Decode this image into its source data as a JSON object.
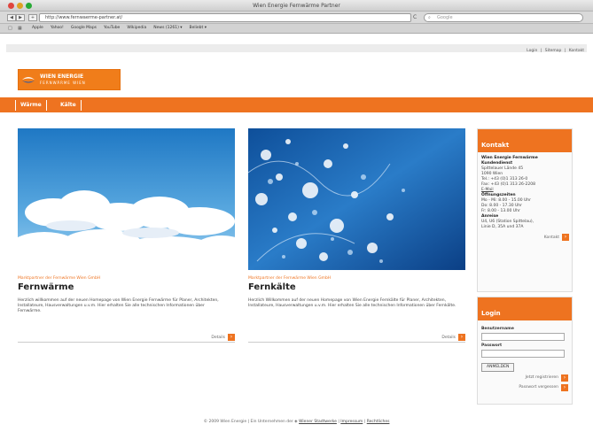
{
  "window": {
    "title": "Wien Energie Fernwärme Partner"
  },
  "browser": {
    "back_label": "◀",
    "forward_label": "▶",
    "add_label": "+",
    "url": "http://www.fernwaerme-partner.at/",
    "reload_label": "C",
    "search_placeholder": "Google",
    "bookmarks": [
      "Apple",
      "Yahoo!",
      "Google Maps",
      "YouTube",
      "Wikipedia",
      "News (1261) ▾",
      "Beliebt ▾"
    ]
  },
  "site": {
    "util_nav": {
      "login": "Login",
      "sitemap": "Sitemap",
      "kontakt": "Kontakt",
      "sep": "|"
    },
    "logo": {
      "line1": "WIEN ENERGIE",
      "line2": "FERNWÄRME WIEN"
    },
    "nav": {
      "waerme": "Wärme",
      "kaelte": "Kälte"
    }
  },
  "teasers": {
    "waerme": {
      "kicker": "Marktpartner der Fernwärme Wien GmbH",
      "title": "Fernwärme",
      "body": "Herzlich willkommen auf der neuen Homepage von Wien Energie Fernwärme für Planer, Architekten, Installateure, Hausverwaltungen u.v.m. Hier erhalten Sie alle technischen Informationen über Fernwärme.",
      "more": "Details"
    },
    "kaelte": {
      "kicker": "Marktpartner der Fernwärme Wien GmbH",
      "title": "Fernkälte",
      "body": "Herzlich Willkommen auf der neuen Homepage von Wien Energie Fernkälte für Planer, Architekten, Installateure, Hausverwaltungen u.v.m. Hier erhalten Sie alle technischen Informationen über Fernkälte.",
      "more": "Details"
    }
  },
  "sidebar": {
    "kontakt": {
      "title": "Kontakt",
      "org1": "Wien Energie Fernwärme",
      "org2": "Kundendienst",
      "street": "Spittelauer Lände 45",
      "city": "1090 Wien",
      "tel": "Tel.: +43 (0)1 313 26-0",
      "fax": "Fax: +43 (0)1 313 26-2208",
      "email": "E-Mail",
      "hours_title": "Öffnungszeiten",
      "hours1": "Mo - Mi: 8.00 - 15.00 Uhr",
      "hours2": "Do: 8.00 - 17.30 Uhr",
      "hours3": "Fr: 8.00 - 13.00 Uhr",
      "route_title": "Anreise",
      "route1": "U4, U6 (Station Spittelau),",
      "route2": "Linie D, 35A und 37A",
      "more": "Kontakt"
    },
    "login": {
      "title": "Login",
      "username_label": "Benutzername",
      "password_label": "Passwort",
      "button": "ANMELDEN",
      "register": "Jetzt registrieren",
      "forgot": "Passwort vergessen"
    }
  },
  "footer": {
    "copyright": "© 2009 Wien Energie | Ein Unternehmen der",
    "links": [
      "Wiener Stadtwerke",
      "Impressum",
      "Rechtliches"
    ],
    "sep": "|"
  },
  "colors": {
    "accent": "#ee7320",
    "sky": "#3b8fd0",
    "water": "#1d6fb8"
  }
}
